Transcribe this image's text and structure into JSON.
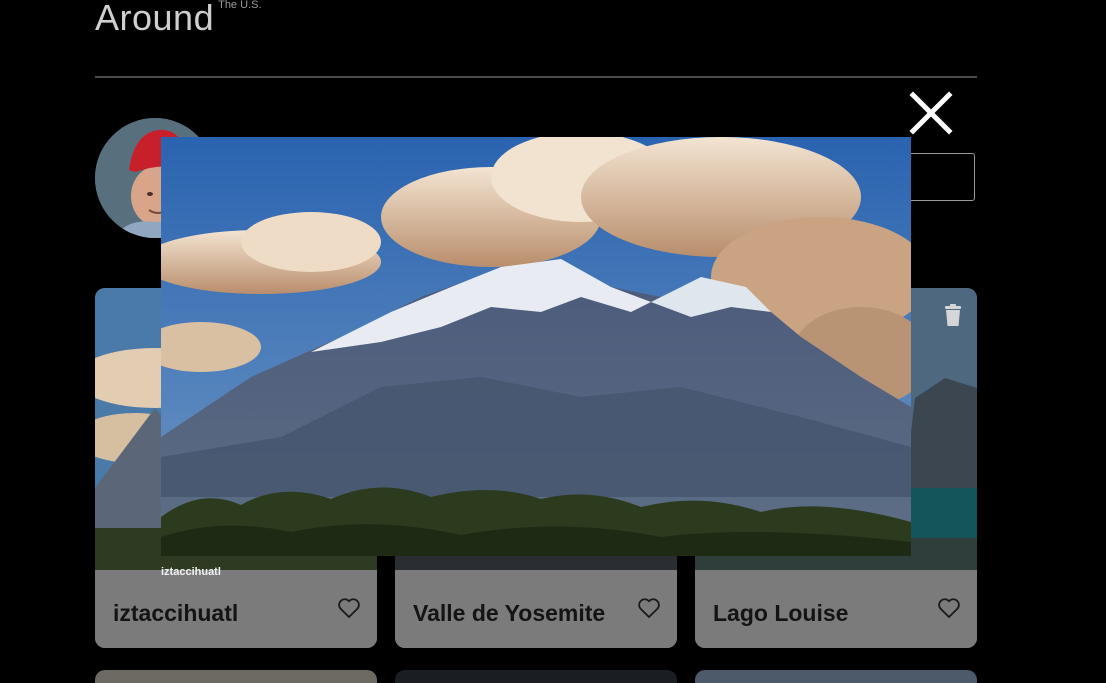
{
  "header": {
    "title": "Around",
    "subtitle": "The U.S."
  },
  "profile": {
    "avatar_alt": "avatar"
  },
  "cards": [
    {
      "title": "iztaccihuatl",
      "liked": false
    },
    {
      "title": "Valle de Yosemite",
      "liked": false
    },
    {
      "title": "Lago Louise",
      "liked": false
    }
  ],
  "modal": {
    "caption": "iztaccihuatl"
  },
  "icons": {
    "close": "close-icon",
    "heart": "heart-icon",
    "trash": "trash-icon"
  },
  "colors": {
    "background": "#000000",
    "card_footer": "#7b7b7b",
    "card_title": "#141414"
  }
}
